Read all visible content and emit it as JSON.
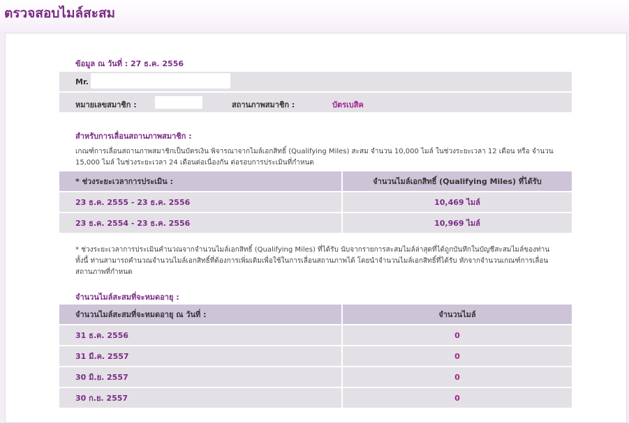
{
  "page_title": "ตรวจสอบไมล์สะสม",
  "as_of": "ข้อมูล ณ วันที่ : 27 ธ.ค. 2556",
  "member": {
    "name_prefix": "Mr.",
    "member_no_label": "หมายเลขสมาชิก :",
    "status_label": "สถานภาพสมาชิก :",
    "status_value": "บัตรเบสิค"
  },
  "qualification": {
    "title": "สำหรับการเลื่อนสถานภาพสมาชิก :",
    "description": "เกณฑ์การเลื่อนสถานภาพสมาชิกเป็นบัตรเงิน พิจารณาจากไมล์เอกสิทธิ์ (Qualifying Miles) สะสม จำนวน 10,000 ไมล์ ในช่วงระยะเวลา 12 เดือน หรือ จำนวน 15,000 ไมล์ ในช่วงระยะเวลา 24 เดือนต่อเนื่องกัน ต่อรอบการประเมินที่กำหนด",
    "headers": [
      "* ช่วงระยะเวลาการประเมิน :",
      "จำนวนไมล์เอกสิทธิ์ (Qualifying Miles) ที่ได้รับ"
    ],
    "rows": [
      {
        "period": "23 ธ.ค. 2555  -  23 ธ.ค. 2556",
        "miles": "10,469 ไมล์"
      },
      {
        "period": "23 ธ.ค. 2554  -  23 ธ.ค. 2556",
        "miles": "10,969 ไมล์"
      }
    ],
    "footnote": "* ช่วงระยะเวลาการประเมินคำนวณจากจำนวนไมล์เอกสิทธิ์ (Qualifying Miles) ที่ได้รับ นับจากรายการสะสมไมล์ล่าสุดที่ได้ถูกบันทึกในบัญชีสะสมไมล์ของท่าน ทั้งนี้ ท่านสามารถคำนวณจำนวนไมล์เอกสิทธิ์ที่ต้องการเพิ่มเติมเพื่อใช้ในการเลื่อนสถานภาพได้ โดยนำจำนวนไมล์เอกสิทธิ์ที่ได้รับ หักจากจำนวนเกณฑ์การเลื่อนสถานภาพที่กำหนด"
  },
  "expiring": {
    "title": "จำนวนไมล์สะสมที่จะหมดอายุ :",
    "headers": [
      "จำนวนไมล์สะสมที่จะหมดอายุ ณ วันที่ :",
      "จำนวนไมล์"
    ],
    "rows": [
      {
        "date": "31 ธ.ค. 2556",
        "miles": "0"
      },
      {
        "date": "31 มี.ค. 2557",
        "miles": "0"
      },
      {
        "date": "30 มิ.ย. 2557",
        "miles": "0"
      },
      {
        "date": "30 ก.ย. 2557",
        "miles": "0"
      }
    ]
  }
}
